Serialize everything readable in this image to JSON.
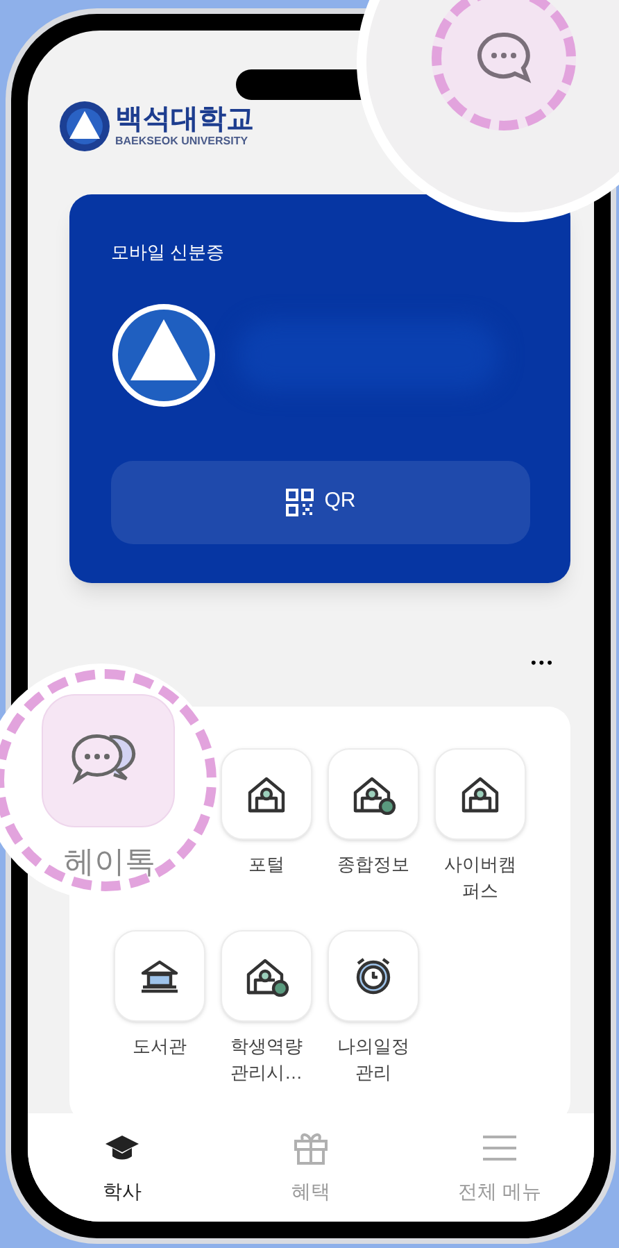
{
  "header": {
    "name": "백석대학교",
    "name_en": "BAEKSEOK UNIVERSITY"
  },
  "id_card": {
    "title": "모바일 신분증",
    "button": "QR"
  },
  "more": "•••",
  "apps": [
    {
      "label": "헤이톡",
      "kind": "chat",
      "magnified": true
    },
    {
      "label": "포털",
      "kind": "building",
      "magnified": false
    },
    {
      "label": "종합정보",
      "kind": "building-info",
      "magnified": false
    },
    {
      "label": "사이버캠퍼스",
      "kind": "building",
      "magnified": false
    },
    {
      "label": "도서관",
      "kind": "library",
      "magnified": false
    },
    {
      "label": "학생역량 관리시…",
      "kind": "building-info",
      "magnified": false
    },
    {
      "label": "나의일정 관리",
      "kind": "clock",
      "magnified": false
    }
  ],
  "nav": [
    {
      "label": "학사",
      "kind": "cap",
      "selected": true
    },
    {
      "label": "혜택",
      "kind": "gift",
      "selected": false
    },
    {
      "label": "전체 메뉴",
      "kind": "menu",
      "selected": false
    }
  ]
}
